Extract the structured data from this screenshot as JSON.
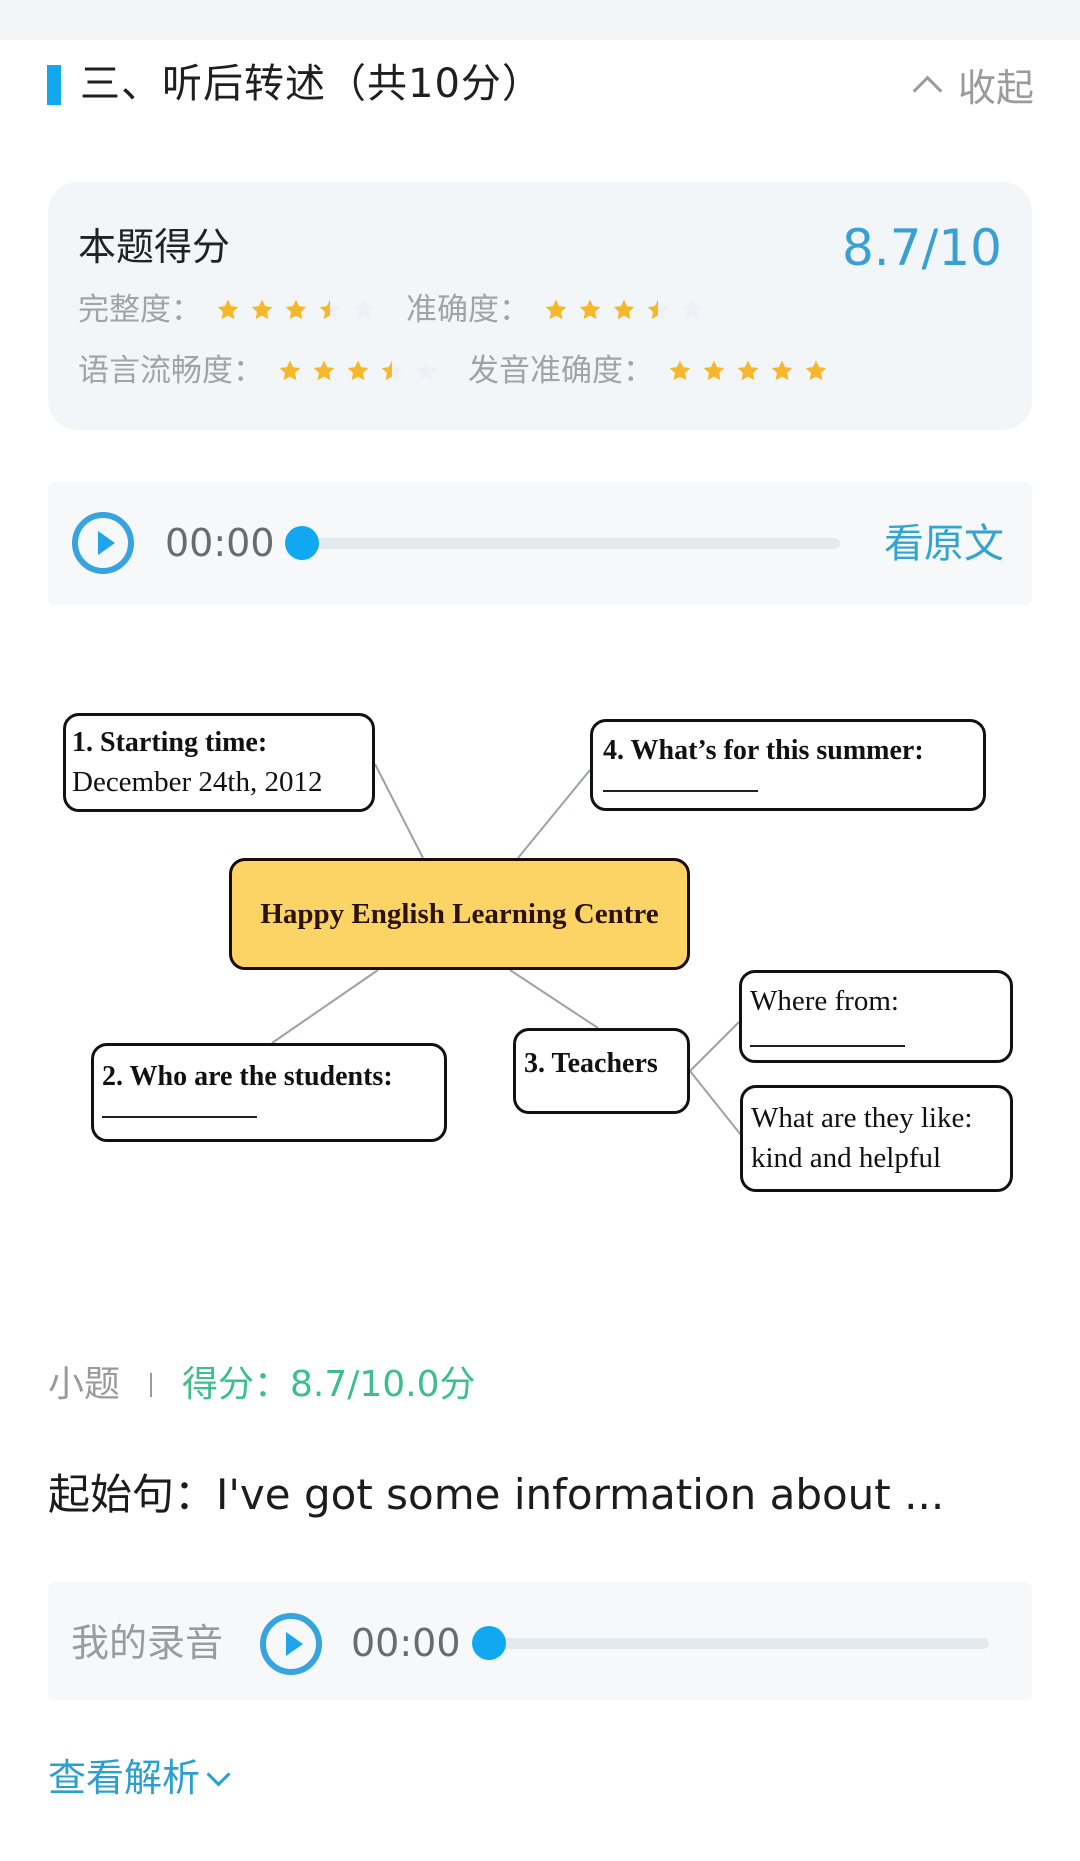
{
  "section": {
    "title": "三、听后转述（共10分）",
    "collapse_label": "收起",
    "accent_color": "#12a9ec"
  },
  "score_card": {
    "title": "本题得分",
    "total": "8.7/10",
    "ratings": [
      {
        "label": "完整度：",
        "stars": 3.5,
        "max": 5
      },
      {
        "label": "准确度：",
        "stars": 3.5,
        "max": 5
      },
      {
        "label": "语言流畅度：",
        "stars": 3.5,
        "max": 5
      },
      {
        "label": "发音准确度：",
        "stars": 5,
        "max": 5
      }
    ]
  },
  "audio_player": {
    "time": "00:00",
    "progress": 0,
    "view_original_label": "看原文"
  },
  "mindmap": {
    "center": "Happy English Learning Centre",
    "nodes": {
      "starting_time": {
        "title": "1. Starting  time:",
        "value": "December 24th, 2012"
      },
      "summer": {
        "title": "4. What’s for this summer:"
      },
      "students": {
        "title": "2. Who are the students:"
      },
      "teachers": {
        "title": "3. Teachers"
      },
      "where_from": {
        "title": "Where from:"
      },
      "like": {
        "title": "What are they like:",
        "value": "kind and helpful"
      }
    }
  },
  "subquestion": {
    "label": "小题",
    "score": "得分：8.7/10.0分",
    "score_color": "#3cbf8c",
    "start_sentence": "起始句：I've got some information about ..."
  },
  "recording": {
    "label": "我的录音",
    "time": "00:00",
    "progress": 0
  },
  "analysis": {
    "label": "查看解析"
  }
}
